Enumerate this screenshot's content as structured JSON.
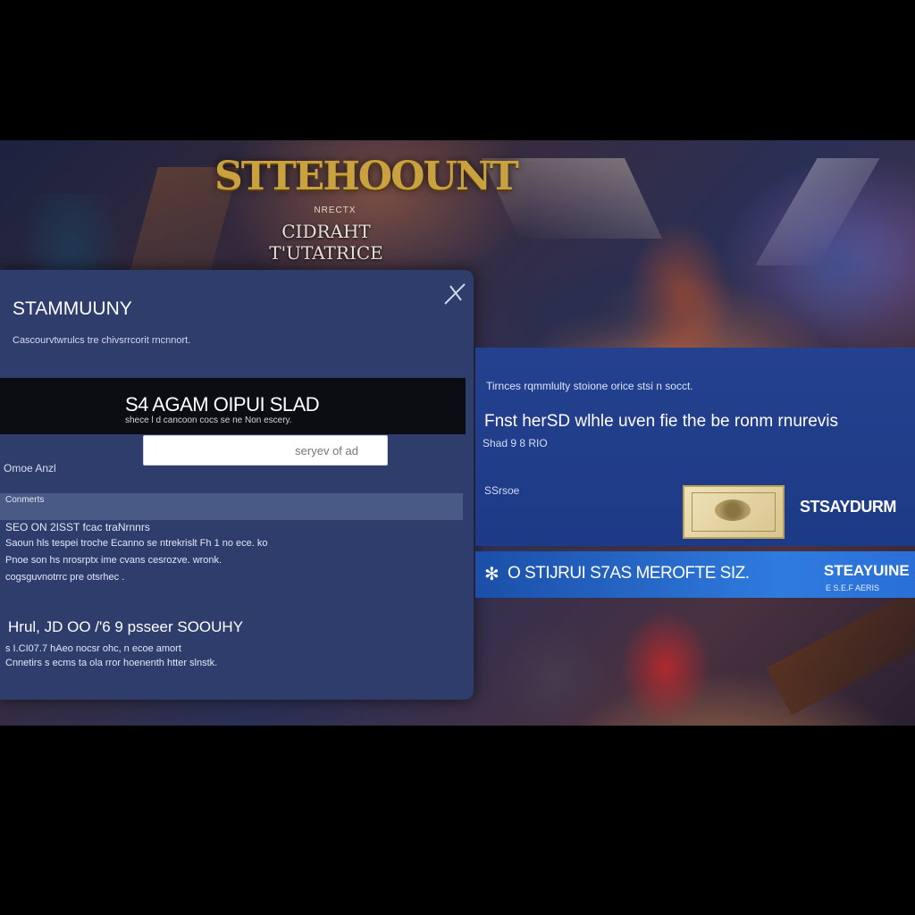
{
  "logo": {
    "title": "STTEHOOUNT",
    "small": "NRECTX",
    "subtitle": "CIDRAHT T'UTATRICE"
  },
  "dialog": {
    "title": "STAMMUUNY",
    "description": "Cascourvtwrulcs tre chivsrrcorit rncnnort.",
    "close_icon": "close-icon",
    "band_title": "S4 AGAM OIPUI SLAD",
    "band_subtitle": "shece l d cancoon cocs se ne Non escery.",
    "search_placeholder": "seryev of ad",
    "field_label": "Omoe Anzl",
    "section_label": "Conmerts",
    "list": [
      "SEO ON 2ISST fcac traNrnnrs",
      "Saoun hls tespei troche Ecanno se ntrekrislt Fh 1 no ece. ko",
      "Pnoe son hs nrosrptx ime cvans cesrozve. wronk.",
      "cogsguvnotrrc pre otsrhec ."
    ],
    "footer_title": "Hrul, JD OO /'6 9 psseer SOOUHY",
    "footer_lines": [
      "s I.CI07.7 hAeo nocsr ohc, n ecoe amort",
      "Cnnetirs s ecms ta ola rror hoenenth htter slnstk."
    ]
  },
  "promo": {
    "top_text": "Tirnces rqmmlulty stoione orice stsi n socct.",
    "headline": "Fnst herSD wlhle uven fie the be ronm rnurevis",
    "subline": "Shad 9 8 RIO",
    "label": "SSrsoe",
    "brand": "STSAYDURM"
  },
  "strip": {
    "icon": "steam-logo-icon",
    "text": "O STIJRUI S7AS MEROFTE SIZ.",
    "brand": "STEAYUINE",
    "brand_sub": "E S.E.F AERIS"
  },
  "colors": {
    "dialog_bg": "#2e3d6c",
    "promo_bg": "#1d3a86",
    "strip_bg": "#2f7be0",
    "logo_gold": "#c9a23f"
  }
}
